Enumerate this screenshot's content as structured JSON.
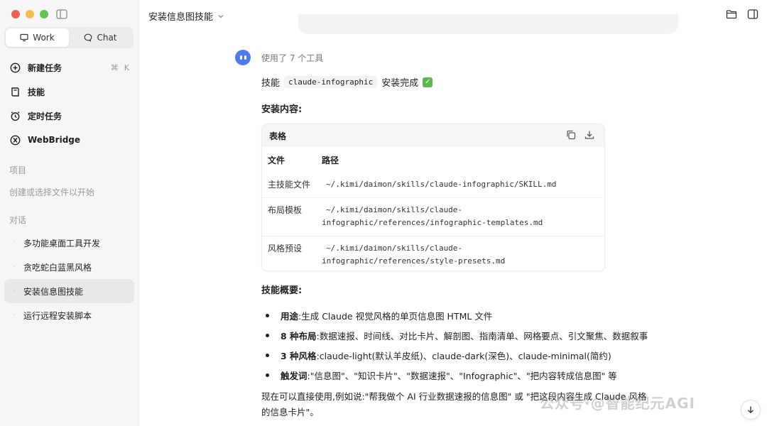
{
  "sidebar": {
    "mode_tabs": [
      {
        "label": "Work",
        "icon": "monitor-icon",
        "active": true
      },
      {
        "label": "Chat",
        "icon": "chat-bubble-icon",
        "active": false
      }
    ],
    "nav": [
      {
        "label": "新建任务",
        "icon": "plus-circle-icon",
        "shortcut": [
          "⌘",
          "K"
        ]
      },
      {
        "label": "技能",
        "icon": "book-icon"
      },
      {
        "label": "定时任务",
        "icon": "alarm-clock-icon"
      },
      {
        "label": "WebBridge",
        "icon": "webbridge-icon"
      }
    ],
    "projects_label": "项目",
    "projects_hint": "创建或选择文件以开始",
    "conversations_label": "对话",
    "conversations": [
      {
        "label": "多功能桌面工具开发",
        "active": false
      },
      {
        "label": "贪吃蛇白蓝黑风格",
        "active": false
      },
      {
        "label": "安装信息图技能",
        "active": true
      },
      {
        "label": "运行远程安装脚本",
        "active": false
      }
    ]
  },
  "header": {
    "title": "安装信息图技能"
  },
  "message": {
    "tools_used": "使用了 7 个工具",
    "line1_prefix": "技能",
    "skill_name": "claude-infographic",
    "line1_suffix": "安装完成",
    "install_heading": "安装内容:",
    "table": {
      "title": "表格",
      "columns": [
        "文件",
        "路径"
      ],
      "rows": [
        {
          "file": "主技能文件",
          "path": "~/.kimi/daimon/skills/claude-infographic/SKILL.md"
        },
        {
          "file": "布局模板",
          "path_line1": "~/.kimi/daimon/skills/claude-",
          "path_line2": "infographic/references/infographic-templates.md"
        },
        {
          "file": "风格预设",
          "path_line1": "~/.kimi/daimon/skills/claude-",
          "path_line2": "infographic/references/style-presets.md"
        }
      ]
    },
    "overview_heading": "技能概要:",
    "bullets": [
      {
        "key": "用途",
        "text": ":生成 Claude 视觉风格的单页信息图 HTML 文件"
      },
      {
        "key": "8 种布局",
        "text": ":数据速报、时间线、对比卡片、解剖图、指南清单、网格要点、引文聚焦、数据叙事"
      },
      {
        "key": "3 种风格",
        "text": ":claude-light(默认羊皮纸)、claude-dark(深色)、claude-minimal(简约)"
      },
      {
        "key": "触发词",
        "text": ":\"信息图\"、\"知识卡片\"、\"数据速报\"、\"Infographic\"、\"把内容转成信息图\" 等"
      }
    ],
    "closing_line1": "现在可以直接使用,例如说:\"帮我做个 AI 行业数据速报的信息图\" 或 \"把这段内容生成 Claude 风格",
    "closing_line2": "的信息卡片\"。"
  },
  "watermark": "公众号·@智能纪元AGI"
}
